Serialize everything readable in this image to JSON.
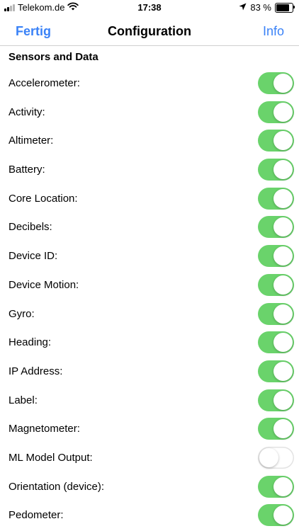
{
  "status_bar": {
    "carrier": "Telekom.de",
    "time": "17:38",
    "battery": "83 %",
    "battery_level": 0.83,
    "icons": [
      "signal-icon",
      "wifi-icon",
      "location-arrow-icon",
      "battery-icon"
    ]
  },
  "nav": {
    "left_button": "Fertig",
    "title": "Configuration",
    "right_button": "Info"
  },
  "section": {
    "title": "Sensors and Data"
  },
  "rows": [
    {
      "label": "Accelerometer:",
      "on": true
    },
    {
      "label": "Activity:",
      "on": true
    },
    {
      "label": "Altimeter:",
      "on": true
    },
    {
      "label": "Battery:",
      "on": true
    },
    {
      "label": "Core Location:",
      "on": true
    },
    {
      "label": "Decibels:",
      "on": true
    },
    {
      "label": "Device ID:",
      "on": true
    },
    {
      "label": "Device Motion:",
      "on": true
    },
    {
      "label": "Gyro:",
      "on": true
    },
    {
      "label": "Heading:",
      "on": true
    },
    {
      "label": "IP Address:",
      "on": true
    },
    {
      "label": "Label:",
      "on": true
    },
    {
      "label": "Magnetometer:",
      "on": true
    },
    {
      "label": "ML Model Output:",
      "on": false
    },
    {
      "label": "Orientation (device):",
      "on": true
    },
    {
      "label": "Pedometer:",
      "on": true
    }
  ],
  "colors": {
    "accent": "#3a82f7",
    "toggle_on": "#6ad36b"
  }
}
